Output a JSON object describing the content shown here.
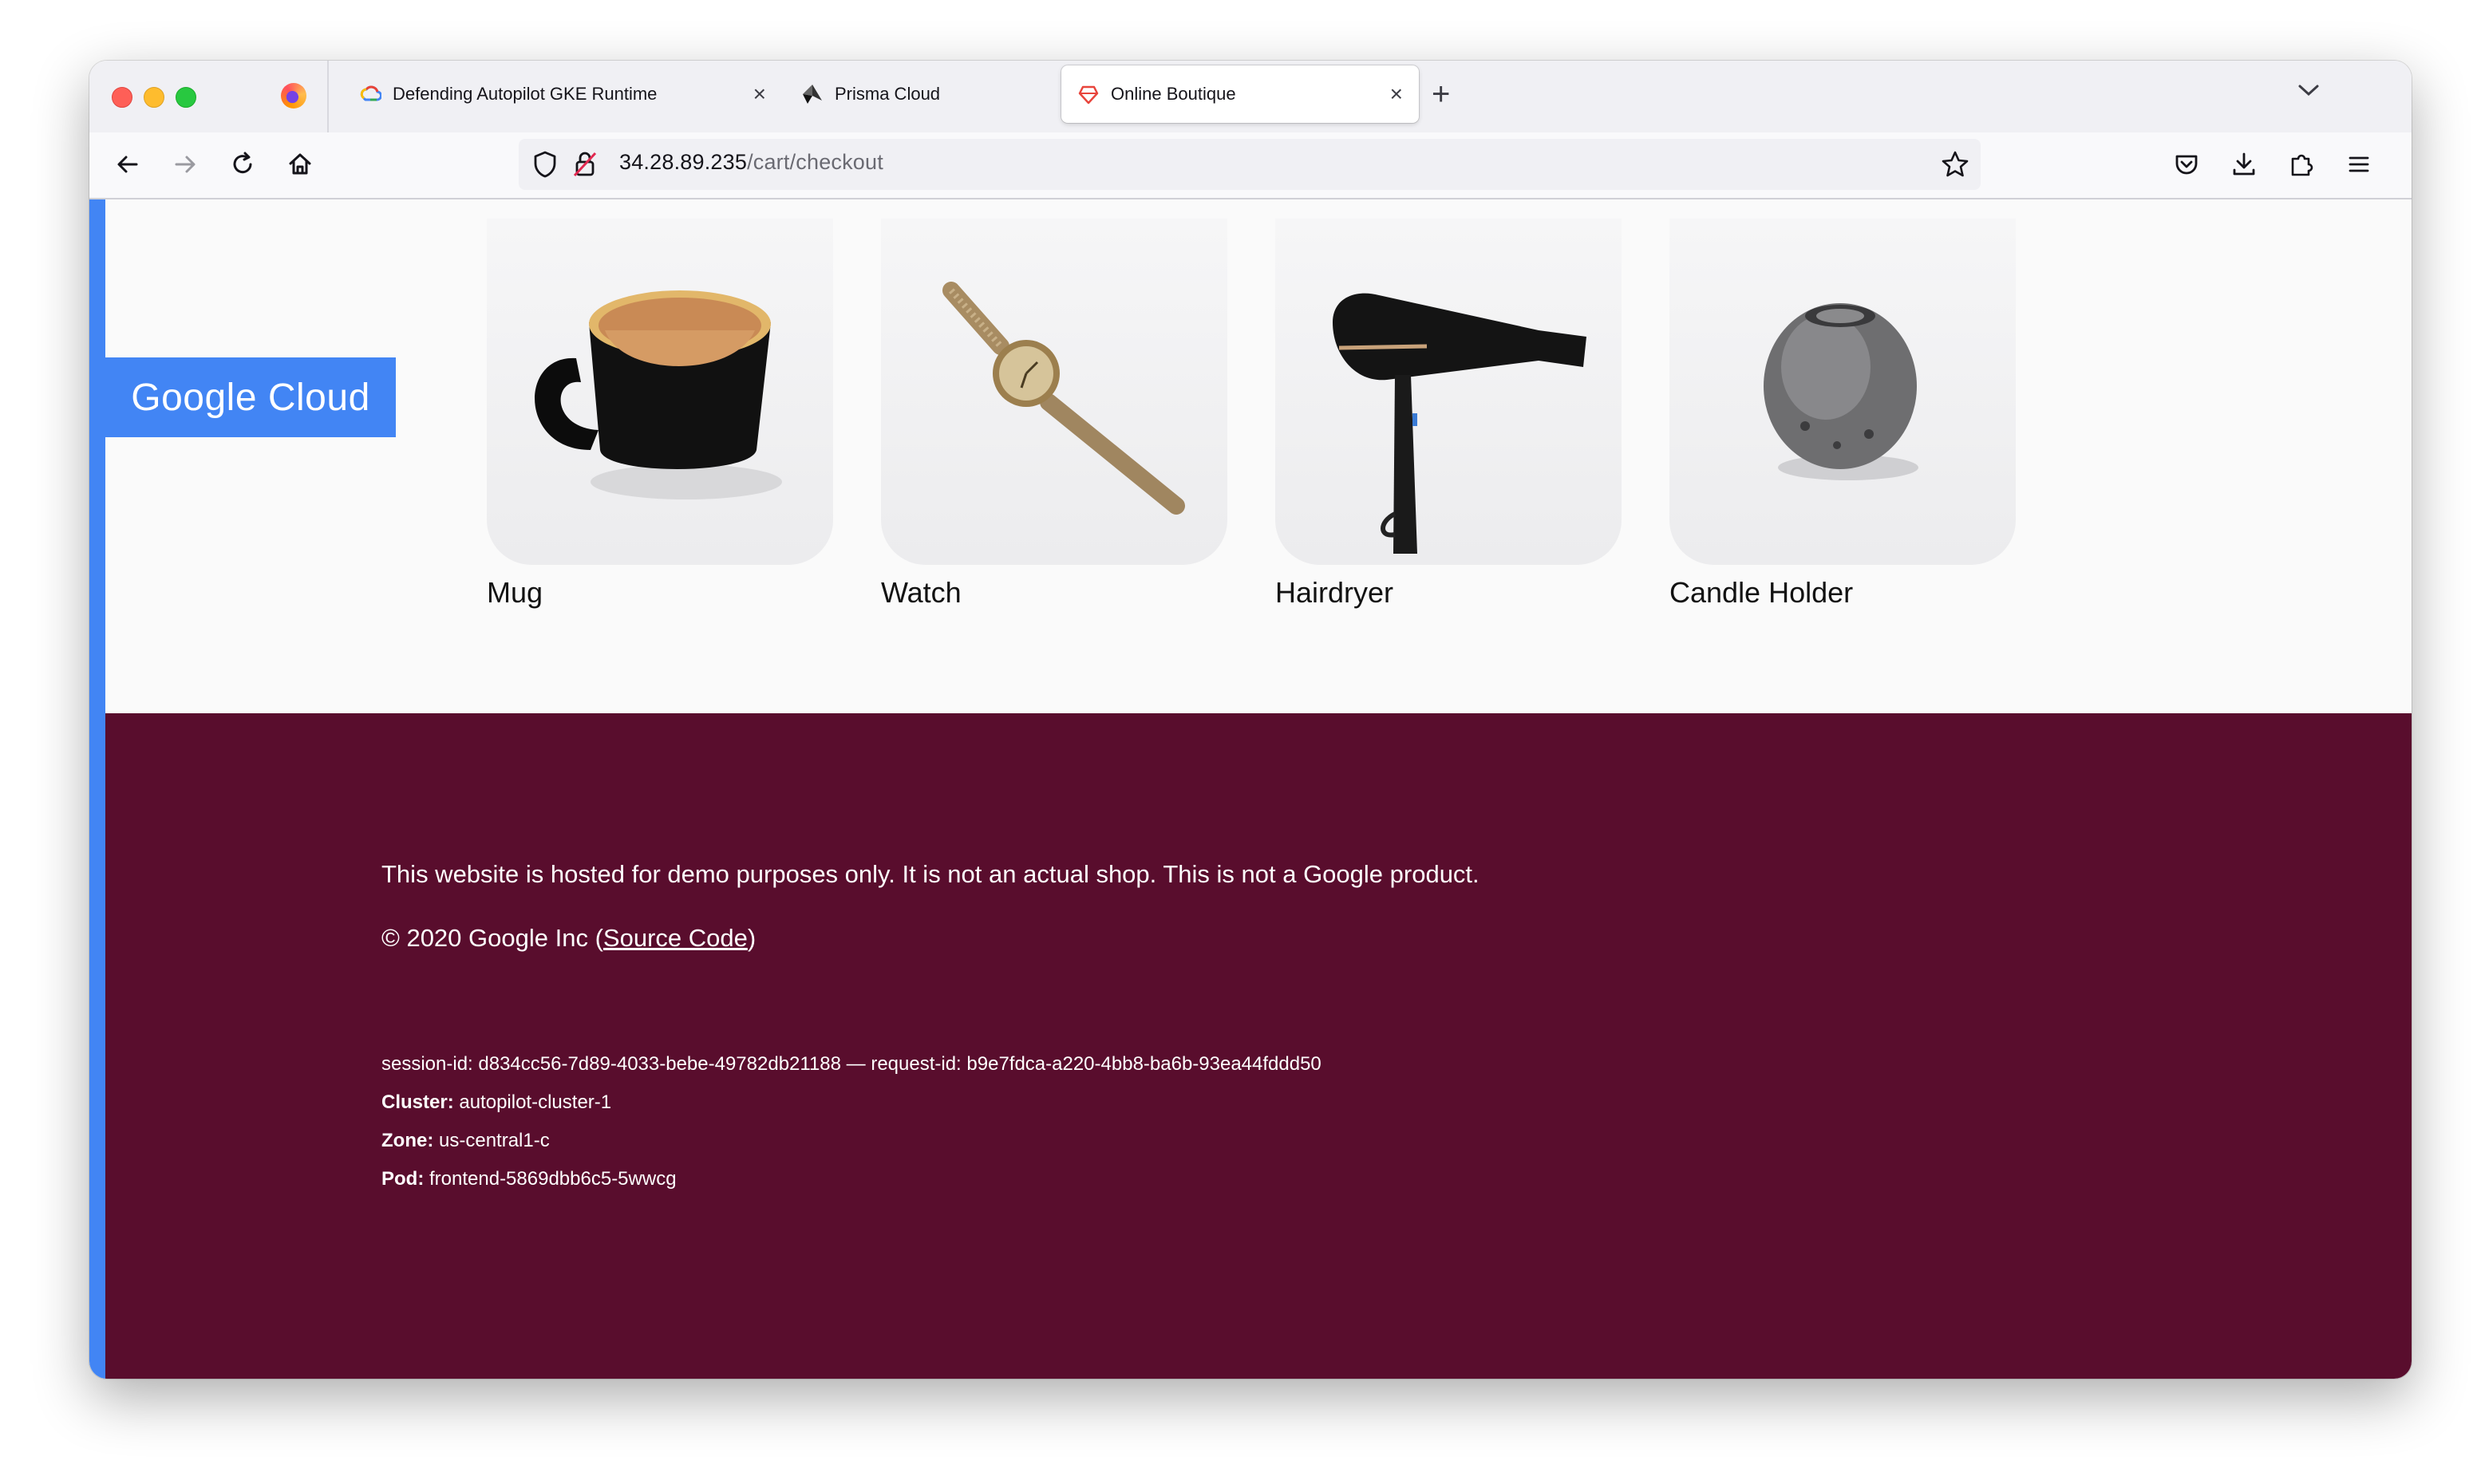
{
  "browser": {
    "tabs": [
      {
        "title": "Defending Autopilot GKE Runtime",
        "active": false
      },
      {
        "title": "Prisma Cloud",
        "active": false
      },
      {
        "title": "Online Boutique",
        "active": true
      }
    ],
    "url_host": "34.28.89.235",
    "url_path": "/cart/checkout"
  },
  "page": {
    "badge": "Google Cloud",
    "products": [
      {
        "name": "Mug"
      },
      {
        "name": "Watch"
      },
      {
        "name": "Hairdryer"
      },
      {
        "name": "Candle Holder"
      }
    ]
  },
  "footer": {
    "disclaimer": "This website is hosted for demo purposes only. It is not an actual shop. This is not a Google product.",
    "copyright_prefix": "© 2020 Google Inc (",
    "source_link": "Source Code",
    "copyright_suffix": ")",
    "session_line": "session-id: d834cc56-7d89-4033-bebe-49782db21188 — request-id: b9e7fdca-a220-4bb8-ba6b-93ea44fddd50",
    "cluster_label": "Cluster:",
    "cluster_value": "autopilot-cluster-1",
    "zone_label": "Zone:",
    "zone_value": "us-central1-c",
    "pod_label": "Pod:",
    "pod_value": "frontend-5869dbb6c5-5wwcg"
  },
  "colors": {
    "accent_blue": "#4285f4",
    "footer_bg": "#590d2d"
  }
}
